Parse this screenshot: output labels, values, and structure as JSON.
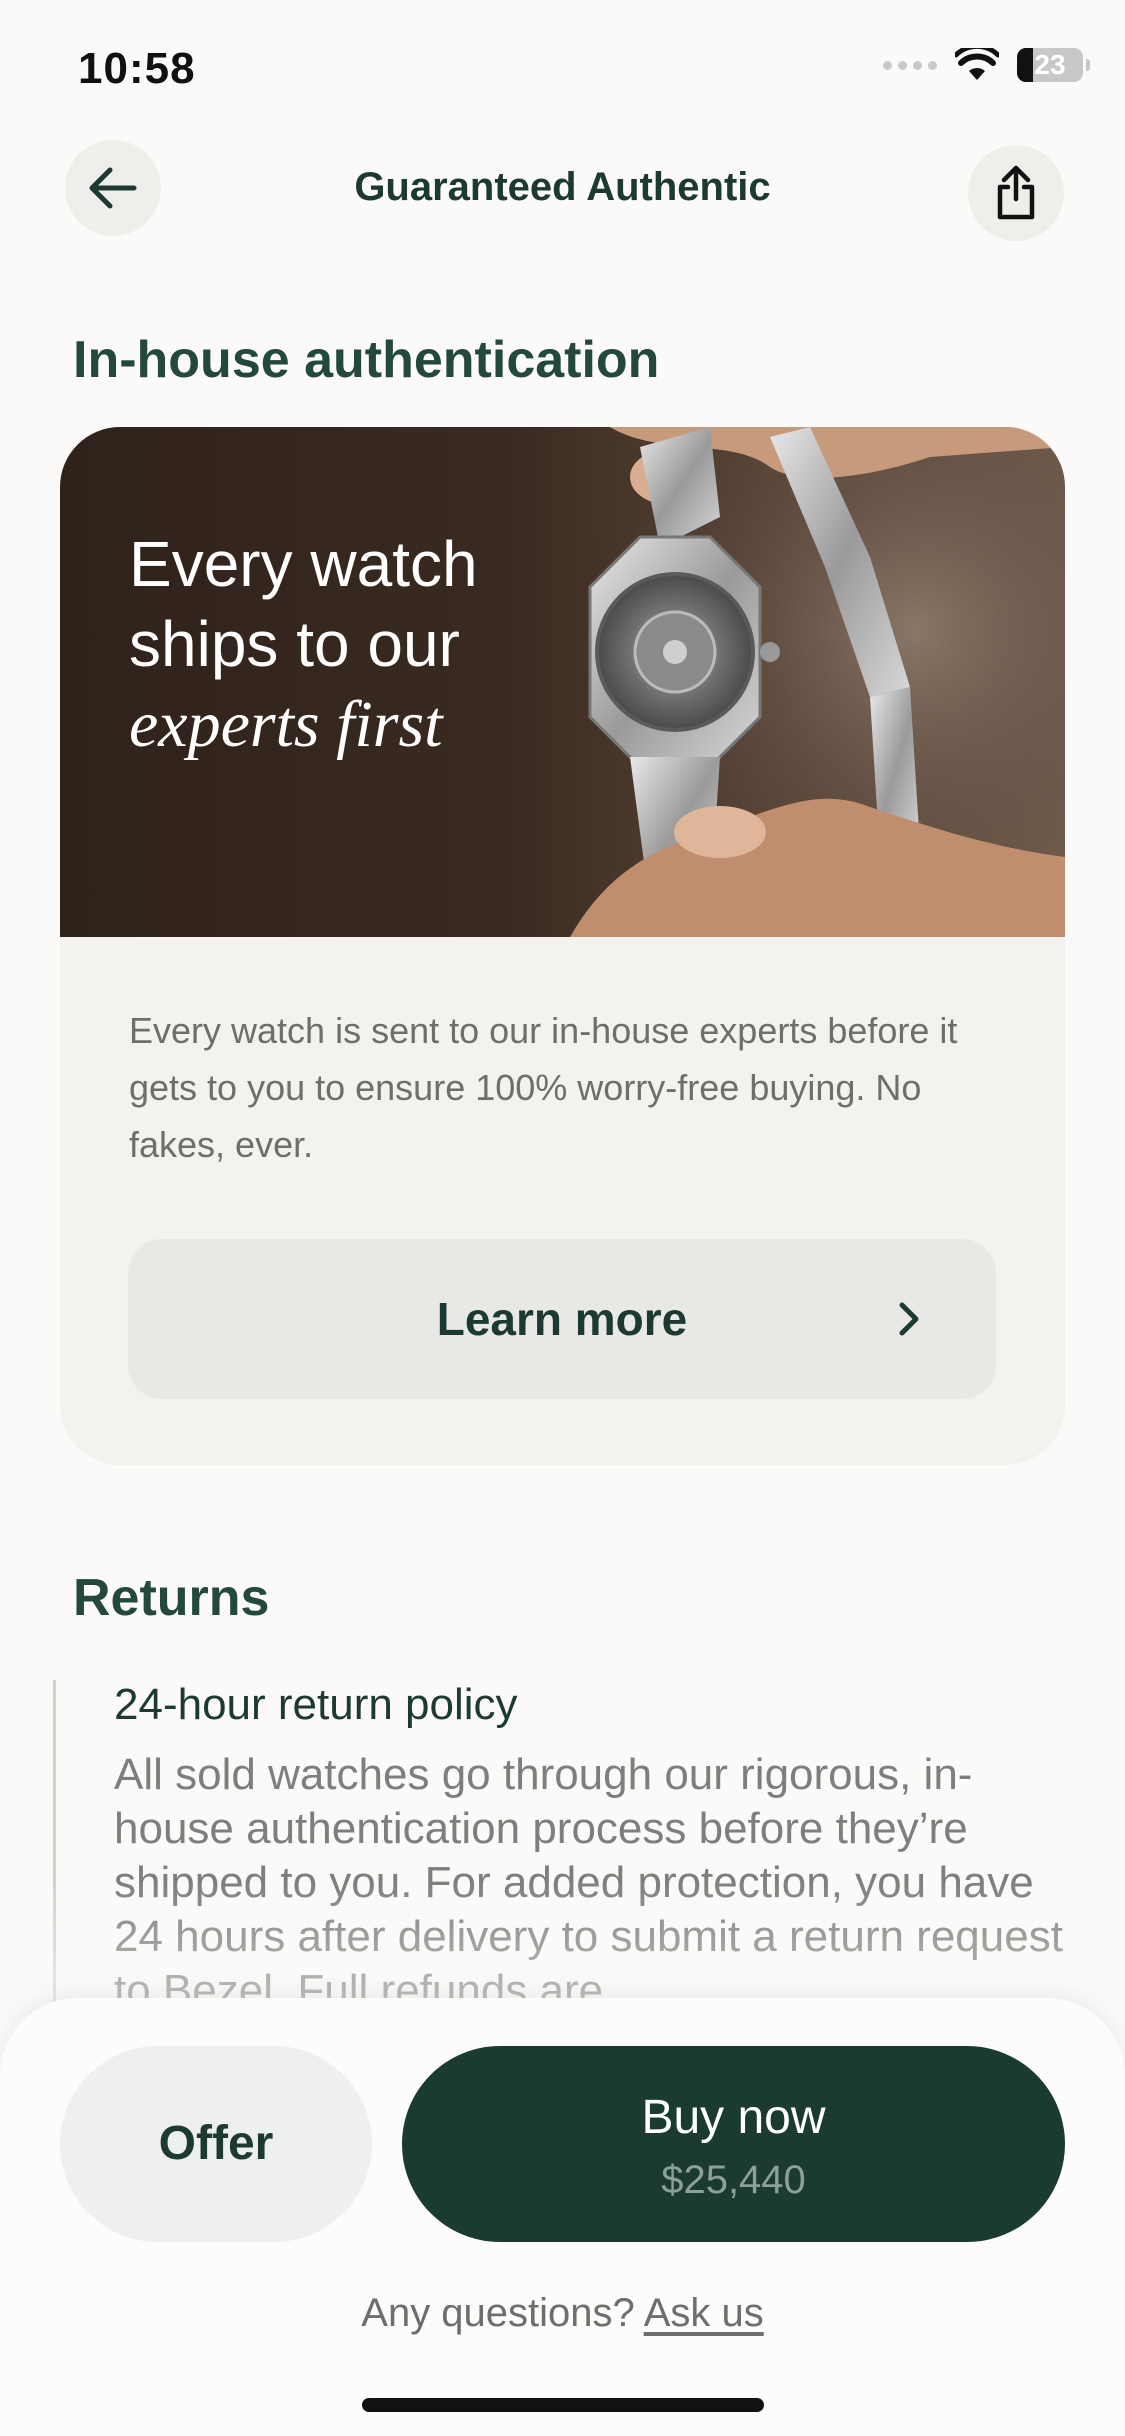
{
  "status_bar": {
    "time": "10:58",
    "battery": "23"
  },
  "header": {
    "title": "Guaranteed Authentic"
  },
  "auth_section": {
    "title": "In-house authentication",
    "hero_line1": "Every watch",
    "hero_line2": "ships to our",
    "hero_line3": "experts first",
    "description": "Every watch is sent to our in-house experts before it gets to you to ensure 100% worry-free buying. No fakes, ever.",
    "learn_more": "Learn more"
  },
  "returns": {
    "title": "Returns",
    "subtitle": "24-hour return policy",
    "body": "All sold watches go through our rigorous, in-house authentication process before they’re shipped to you. For added protection, you have 24 hours after delivery to submit a return request to Bezel. Full refunds are"
  },
  "bottom_bar": {
    "offer": "Offer",
    "buy_now": "Buy now",
    "price": "$25,440",
    "questions": "Any questions?",
    "ask_us": "Ask us"
  },
  "icons": {
    "back": "arrow-left-icon",
    "share": "share-icon",
    "chevron": "chevron-right-icon"
  },
  "colors": {
    "primary": "#1b3a31",
    "heading": "#23483d",
    "background": "#fcfaf8",
    "card": "#f3f2ef",
    "hero": "#2f221b"
  }
}
